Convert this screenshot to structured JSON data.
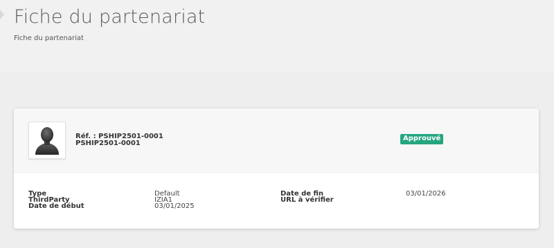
{
  "header": {
    "title": "Fiche du partenariat",
    "breadcrumb": "Fiche du partenariat"
  },
  "card": {
    "avatar_icon": "person-silhouette-icon",
    "ref_line": "Réf. : PSHIP2501-0001",
    "ref_sub": "PSHIP2501-0001",
    "status": "Approuvé",
    "status_color": "#25a580"
  },
  "fields": {
    "type_label": "Type",
    "type_value": "Default",
    "thirdparty_label": "ThirdParty",
    "thirdparty_value": "IZIA1",
    "date_debut_label": "Date de début",
    "date_debut_value": "03/01/2025",
    "date_fin_label": "Date de fin",
    "date_fin_value": "03/01/2026",
    "url_label": "URL à vérifier",
    "url_value": ""
  }
}
